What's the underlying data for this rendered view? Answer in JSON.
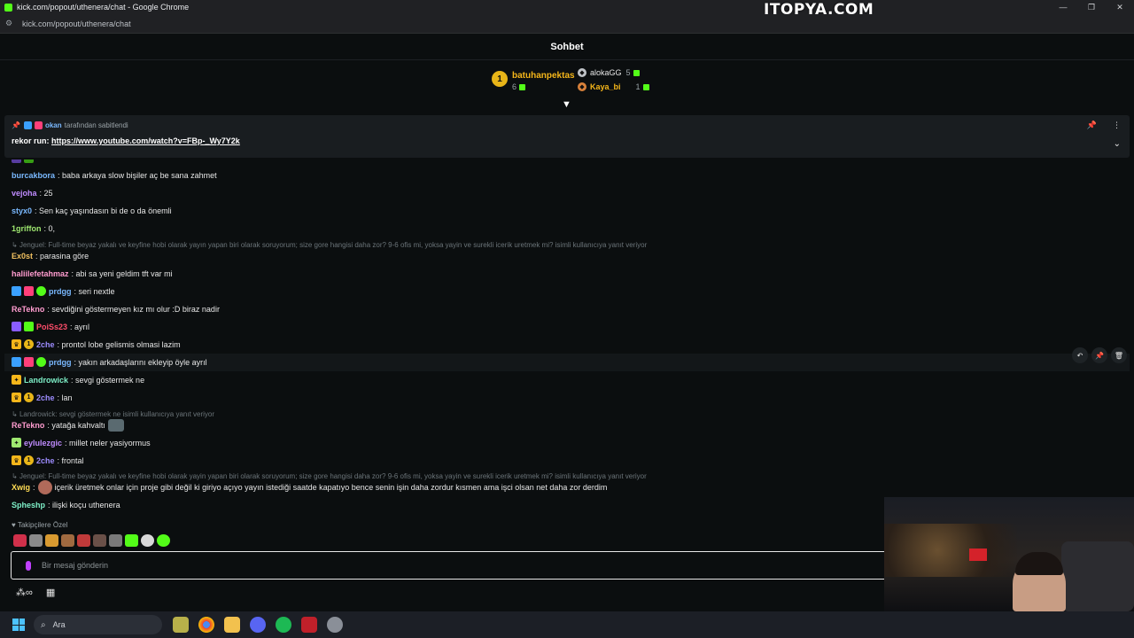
{
  "browser": {
    "window_title": "kick.com/popout/uthenera/chat - Google Chrome",
    "url": "kick.com/popout/uthenera/chat",
    "watermark": "ITOPYA.COM",
    "win_minimize": "—",
    "win_restore": "❐",
    "win_close": "✕"
  },
  "chat": {
    "title": "Sohbet"
  },
  "leaderboard": {
    "first": {
      "rank": "1",
      "name": "batuhanpektas",
      "count": "6"
    },
    "second": {
      "name": "alokaGG",
      "count": "5"
    },
    "third": {
      "name": "Kaya_bi",
      "count": "1"
    }
  },
  "pinned": {
    "pinned_by_user": "okan",
    "pinned_by_text": "tarafından sabitlendi",
    "message_label": "rekor run:",
    "link": "https://www.youtube.com/watch?v=FBp-_Wy7Y2k"
  },
  "messages": [
    {
      "user": "burcakbora",
      "color": "#7ab9ff",
      "text": "baba arkaya slow bişiler aç be sana zahmet"
    },
    {
      "user": "vejoha",
      "color": "#c08cff",
      "text": "25"
    },
    {
      "user": "styx0",
      "color": "#7ab9ff",
      "text": "Sen kaç yaşındasın bi de o da önemli"
    },
    {
      "user": "1griffon",
      "color": "#9fe870",
      "text": "0,"
    },
    {
      "reply": "Jenguel: Full-time beyaz yakalı ve keyfine hobi olarak yayın yapan biri olarak soruyorum; size gore hangisi daha zor? 9-6 ofis mi, yoksa yayin ve surekli icerik uretmek mi? isimli kullanıcıya yanıt veriyor"
    },
    {
      "user": "Ex0st",
      "color": "#f0c060",
      "text": "parasina göre"
    },
    {
      "user": "haliilefetahmaz",
      "color": "#ff9ccf",
      "text": "abi sa yeni geldim tft var mi"
    },
    {
      "user": "prdgg",
      "color": "#7ab9ff",
      "text": "seri nextle"
    },
    {
      "user": "ReTekno",
      "color": "#ff9ccf",
      "text": "sevdiğini göstermeyen kız mı olur :D biraz nadir"
    },
    {
      "user": "PoiSs23",
      "color": "#ff4d6a",
      "text": "ayrıl"
    },
    {
      "user": "2che",
      "color": "#9d8cff",
      "text": "prontol lobe gelismis olmasi lazim"
    },
    {
      "user": "prdgg",
      "color": "#7ab9ff",
      "text": "yakın arkadaşlarını ekleyip öyle ayrıl"
    },
    {
      "user": "Landrowick",
      "color": "#7ef0c8",
      "text": "sevgi göstermek ne"
    },
    {
      "user": "2che",
      "color": "#9d8cff",
      "text": "lan"
    },
    {
      "reply": "Landrowick: sevgi göstermek ne isimli kullanıcıya yanıt veriyor"
    },
    {
      "user": "ReTekno",
      "color": "#ff9ccf",
      "text": "yatağa kahvaltı"
    },
    {
      "user": "eylulezgic",
      "color": "#c08cff",
      "text": "millet neler yasiyormus"
    },
    {
      "user": "2che",
      "color": "#9d8cff",
      "text": "frontal"
    },
    {
      "reply": "Jenguel: Full-time beyaz yakalı ve keyfine hobi olarak yayin yapan biri olarak soruyorum; size gore hangisi daha zor? 9-6 ofis mi, yoksa yayin ve surekli icerik uretmek mi? isimli kullanıcıya yanıt veriyor"
    },
    {
      "user": "Xwig",
      "color": "#ffdd55",
      "text": "içerik üretmek onlar için proje gibi değil ki giriyo açıyo yayın istediği saatde kapatıyo bence senin işin daha zordur kısmen ama işci olsan net daha zor derdim"
    },
    {
      "user": "Spheshp",
      "color": "#7ef0c8",
      "text": "ilişki koçu uthenera"
    }
  ],
  "footer": {
    "followers_only": "Takipçilere Özel",
    "input_placeholder": "Bir mesaj gönderin"
  },
  "taskbar": {
    "search_placeholder": "Ara"
  },
  "colors": {
    "accent": "#53fc18",
    "background": "#0b0e0f",
    "pinned_bg": "#191d20",
    "gold": "#f5b61a"
  }
}
